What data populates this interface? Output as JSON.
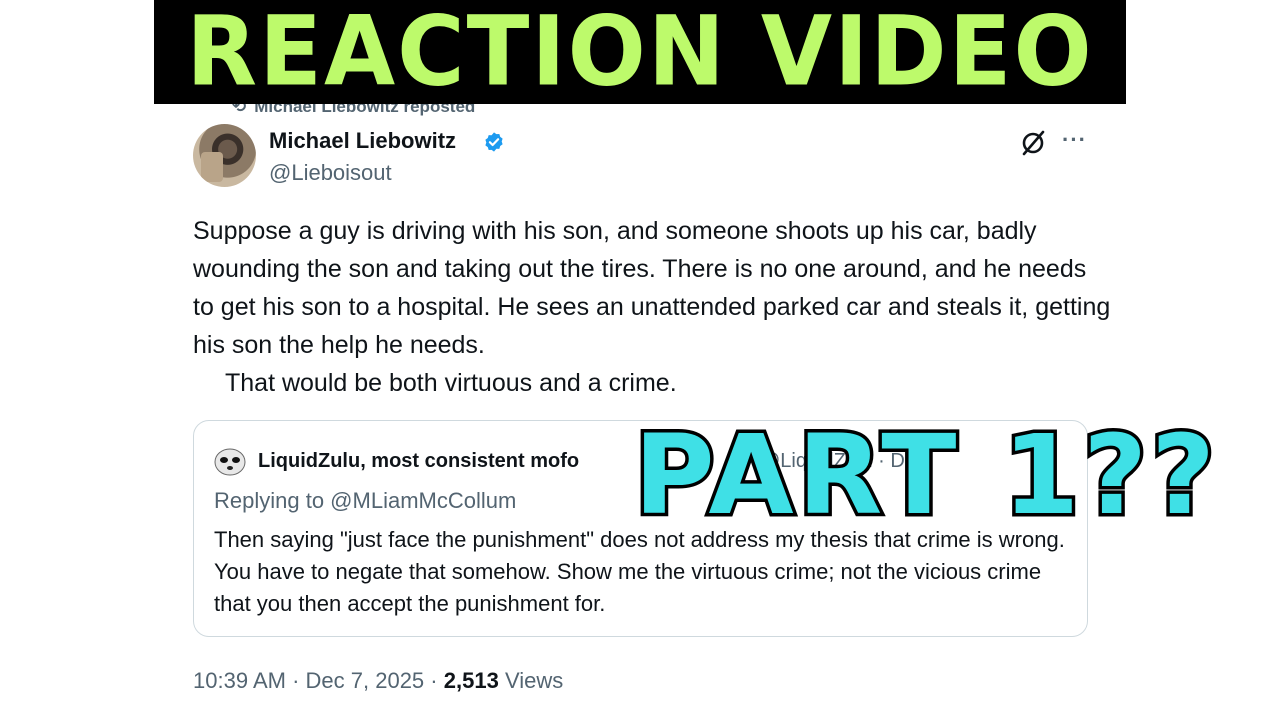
{
  "overlay": {
    "top_banner": "REACTION VIDEO",
    "part_label": "PART  1??"
  },
  "repost": {
    "icon": "repost-icon",
    "text": "Michael Liebowitz reposted"
  },
  "author": {
    "name": "Michael Liebowitz",
    "handle": "@Lieboisout",
    "verified": true
  },
  "header_icons": {
    "grok": "grok-icon",
    "more": "···"
  },
  "tweet": {
    "paragraph1": "Suppose a guy is driving with his son, and someone shoots up his car, badly wounding the son and taking out the tires. There is no one around, and he needs to get his son to a hospital. He sees an unattended parked car and steals it, getting his son the help he needs.",
    "paragraph2": "That would be both virtuous and a crime."
  },
  "quote": {
    "name": "LiquidZulu, most consistent mofo",
    "handle_date": "@LiquidZulu · Dec",
    "replying_to": "Replying to @MLiamMcCollum",
    "text": "Then saying \"just face the punishment\" does not address my thesis that crime is wrong. You have to negate that somehow. Show me the virtuous crime; not the vicious crime that you then accept the punishment for."
  },
  "meta": {
    "time": "10:39 AM",
    "date": "Dec 7, 2025",
    "views_count": "2,513",
    "views_label": "Views"
  },
  "colors": {
    "banner_text": "#bdfa6b",
    "part_text": "#3fe0e6",
    "verified": "#1d9bf0",
    "muted": "#536471"
  }
}
